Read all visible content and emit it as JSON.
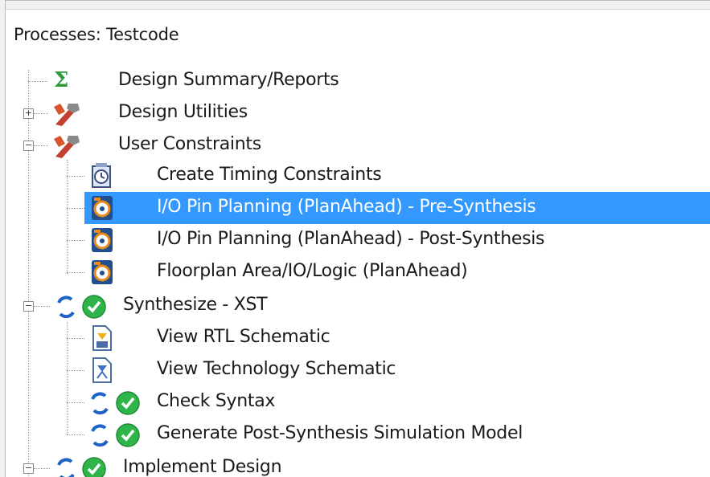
{
  "panel": {
    "title": "Processes: Testcode"
  },
  "items": [
    {
      "label": "Design Summary/Reports",
      "icon": "sigma-icon"
    },
    {
      "label": "Design Utilities",
      "icon": "tools-icon"
    },
    {
      "label": "User Constraints",
      "icon": "tools-icon"
    },
    {
      "label": "Create Timing Constraints",
      "icon": "timing-icon"
    },
    {
      "label": "I/O Pin Planning (PlanAhead) - Pre-Synthesis",
      "icon": "planahead-icon",
      "selected": true
    },
    {
      "label": "I/O Pin Planning (PlanAhead) - Post-Synthesis",
      "icon": "planahead-icon"
    },
    {
      "label": "Floorplan Area/IO/Logic (PlanAhead)",
      "icon": "planahead-icon"
    },
    {
      "label": "Synthesize - XST",
      "icon": "run-check-icon"
    },
    {
      "label": "View RTL Schematic",
      "icon": "schematic-icon"
    },
    {
      "label": "View Technology Schematic",
      "icon": "schematic-icon"
    },
    {
      "label": "Check Syntax",
      "icon": "run-check-icon"
    },
    {
      "label": "Generate Post-Synthesis Simulation Model",
      "icon": "run-check-icon"
    },
    {
      "label": "Implement Design",
      "icon": "run-check-icon"
    }
  ],
  "colors": {
    "selection": "#3399ff",
    "check": "#2fb44a",
    "refresh": "#1e63c8"
  }
}
